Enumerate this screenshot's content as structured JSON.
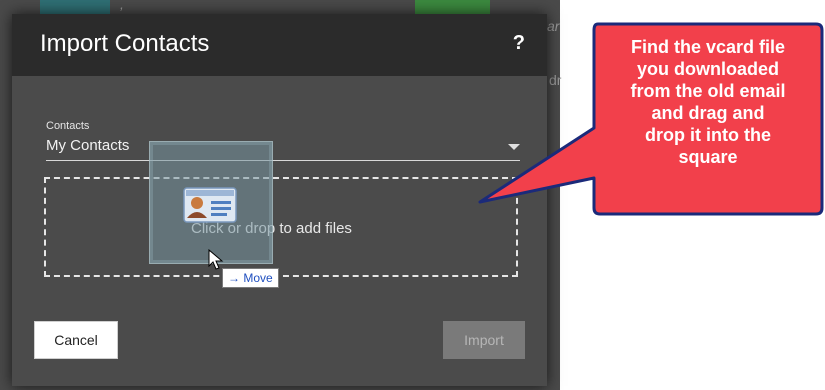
{
  "background": {
    "fragments": [
      ",",
      "ar",
      "dr"
    ]
  },
  "modal": {
    "title": "Import Contacts",
    "help_icon": "?",
    "contacts_label": "Contacts",
    "contacts_selected": "My Contacts",
    "dropzone_text": "Click or drop to add files",
    "drag_tooltip": "→ Move",
    "cancel_label": "Cancel",
    "import_label": "Import"
  },
  "callout": {
    "lines": [
      "Find the vcard file",
      "you downloaded",
      "from the old email",
      "and drag and",
      "drop it into the",
      "square"
    ]
  },
  "colors": {
    "callout_fill": "#f2404b",
    "callout_border": "#1b2a7a",
    "modal_header": "#2b2b2b",
    "modal_body": "#4b4b4b"
  }
}
